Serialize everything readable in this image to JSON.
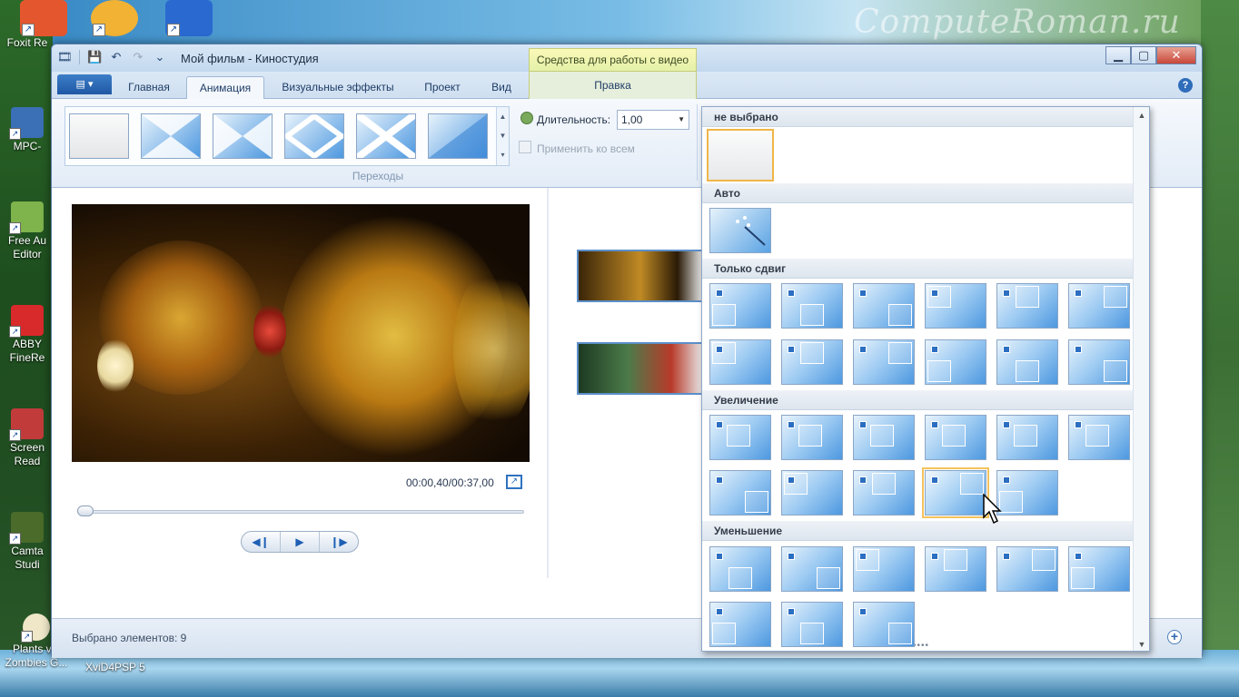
{
  "desktop": {
    "watermark": "ComputeRoman.ru",
    "icons": [
      {
        "label": "Foxit Re",
        "icon": "pdf-icon",
        "color": "#e4572e"
      },
      {
        "label": "MPC-",
        "icon": "media-player-icon",
        "color": "#3b6fb6"
      },
      {
        "label": "Free Au\nEditor",
        "icon": "audio-editor-icon",
        "color": "#7fb34c"
      },
      {
        "label": "ABBY\nFineRe",
        "icon": "abbyy-icon",
        "color": "#d8292b"
      },
      {
        "label": "Screen\nRead",
        "icon": "screen-reader-icon",
        "color": "#c23b3b"
      },
      {
        "label": "Camta\nStudi",
        "icon": "camtasia-icon",
        "color": "#4a6b2a"
      },
      {
        "label": "Plants vs.\nZombies G...",
        "icon": "plants-vs-zombies-icon",
        "color": "#efe7c8"
      }
    ],
    "bottom_label": "XviD4PSP 5"
  },
  "window": {
    "title": "Мой фильм - Киностудия",
    "context_group": "Средства для работы с видео",
    "controls": {
      "minimize": "▁",
      "maximize": "▢",
      "close": "✕"
    }
  },
  "tabs": {
    "file_menu": "▤ ▾",
    "items": [
      "Главная",
      "Анимация",
      "Визуальные эффекты",
      "Проект",
      "Вид"
    ],
    "active": "Анимация",
    "context_tab": "Правка",
    "help": "?"
  },
  "ribbon": {
    "group_label": "Переходы",
    "duration_label": "Длительность:",
    "duration_value": "1,00",
    "apply_all_label": "Применить ко всем"
  },
  "preview": {
    "time": "00:00,40/00:37,00",
    "transport": {
      "prev_frame": "◀❙",
      "play": "▶",
      "next_frame": "❙▶"
    }
  },
  "status": {
    "selected_text": "Выбрано элементов: 9",
    "zoom_in": "+"
  },
  "dropdown": {
    "sections": {
      "none": "не выбрано",
      "auto": "Авто",
      "pan_only": "Только сдвиг",
      "zoom_in": "Увеличение",
      "zoom_out": "Уменьшение"
    },
    "selected_tile": "zoom-in-tile-10",
    "scroll_up": "▲",
    "scroll_down": "▼",
    "grip": "••••"
  },
  "colors": {
    "accent": "#2e72c0",
    "selection": "#f3c35c",
    "tile_blue": "#4d98e0"
  }
}
